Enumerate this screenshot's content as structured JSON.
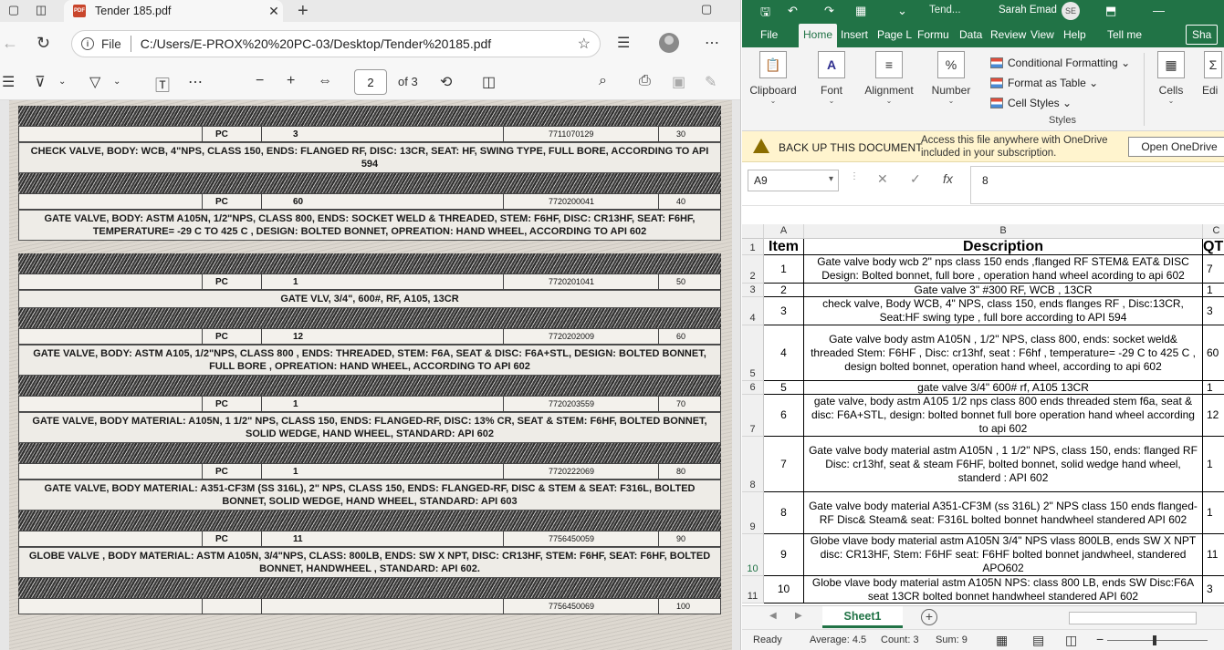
{
  "edge": {
    "tab_title": "Tender 185.pdf",
    "tab_badge": "PDF",
    "url_label": "File",
    "url": "C:/Users/E-PROX%20%20PC-03/Desktop/Tender%20185.pdf",
    "page_current": "2",
    "page_total_label": "of 3"
  },
  "scan": {
    "rows": [
      {
        "pc": "PC",
        "qty": "3",
        "code": "7711070129",
        "no": "30",
        "desc": "CHECK VALVE, BODY: WCB, 4\"NPS, CLASS 150, ENDS: FLANGED RF, DISC: 13CR, SEAT: HF, SWING TYPE, FULL BORE, ACCORDING TO API 594"
      },
      {
        "pc": "PC",
        "qty": "60",
        "code": "7720200041",
        "no": "40",
        "desc": "GATE VALVE, BODY: ASTM A105N, 1/2\"NPS, CLASS 800, ENDS: SOCKET WELD & THREADED, STEM: F6HF, DISC: CR13HF, SEAT: F6HF, TEMPERATURE= -29 C TO 425 C , DESIGN: BOLTED BONNET, OPREATION: HAND WHEEL, ACCORDING TO API 602"
      },
      {
        "pc": "PC",
        "qty": "1",
        "code": "7720201041",
        "no": "50",
        "desc": "GATE VLV, 3/4\", 600#, RF, A105, 13CR"
      },
      {
        "pc": "PC",
        "qty": "12",
        "code": "7720202009",
        "no": "60",
        "desc": "GATE VALVE, BODY: ASTM A105, 1/2\"NPS, CLASS 800 , ENDS: THREADED, STEM: F6A, SEAT & DISC: F6A+STL, DESIGN: BOLTED BONNET, FULL BORE , OPREATION: HAND WHEEL, ACCORDING TO API 602"
      },
      {
        "pc": "PC",
        "qty": "1",
        "code": "7720203559",
        "no": "70",
        "desc": "GATE VALVE, BODY MATERIAL: A105N, 1 1/2\" NPS, CLASS 150, ENDS: FLANGED-RF, DISC: 13% CR, SEAT & STEM: F6HF, BOLTED BONNET, SOLID WEDGE, HAND WHEEL, STANDARD: API 602"
      },
      {
        "pc": "PC",
        "qty": "1",
        "code": "7720222069",
        "no": "80",
        "desc": "GATE VALVE, BODY MATERIAL: A351-CF3M (SS 316L), 2\" NPS, CLASS 150, ENDS: FLANGED-RF, DISC & STEM & SEAT: F316L, BOLTED BONNET, SOLID WEDGE, HAND WHEEL, STANDARD: API 603"
      },
      {
        "pc": "PC",
        "qty": "11",
        "code": "7756450059",
        "no": "90",
        "desc": "GLOBE VALVE , BODY MATERIAL: ASTM A105N, 3/4\"NPS, CLASS: 800LB, ENDS: SW X NPT, DISC: CR13HF, STEM: F6HF, SEAT: F6HF, BOLTED BONNET, HANDWHEEL , STANDARD: API 602."
      },
      {
        "pc": "",
        "qty": "",
        "code": "7756450069",
        "no": "100",
        "desc": ""
      }
    ]
  },
  "excel": {
    "file_short": "Tend...",
    "user_name": "Sarah Emad",
    "user_initials": "SE",
    "menu": [
      "File",
      "Home",
      "Insert",
      "Page L",
      "Formu",
      "Data",
      "Review",
      "View",
      "Help",
      "Tell me",
      "Sha"
    ],
    "ribbon": {
      "clipboard": "Clipboard",
      "font": "Font",
      "alignment": "Alignment",
      "number": "Number",
      "number_icon": "%",
      "conditional": "Conditional Formatting",
      "format_table": "Format as Table",
      "cell_styles": "Cell Styles",
      "styles": "Styles",
      "cells": "Cells",
      "editing": "Edi"
    },
    "message": {
      "title": "BACK UP THIS DOCUMENT",
      "text": "Access this file anywhere with OneDrive included in your subscription.",
      "button": "Open OneDrive"
    },
    "name_box": "A9",
    "fx_label": "fx",
    "formula_value": "8",
    "columns": [
      "A",
      "B",
      "C"
    ],
    "header": {
      "item": "Item",
      "desc": "Description",
      "qty": "QT"
    },
    "rows": [
      {
        "rownum": "2",
        "item": "1",
        "desc": "Gate valve body wcb 2\" nps class 150 ends ,flanged RF STEM& EAT& DISC Design: Bolted bonnet, full bore , operation hand wheel acording to api 602",
        "qty": "7"
      },
      {
        "rownum": "3",
        "item": "2",
        "desc": "Gate valve 3\" #300 RF, WCB , 13CR",
        "qty": "1"
      },
      {
        "rownum": "4",
        "item": "3",
        "desc": "check valve, Body WCB, 4\" NPS, class 150, ends flanges RF , Disc:13CR, Seat:HF swing type , full bore according to API 594",
        "qty": "3"
      },
      {
        "rownum": "5",
        "item": "4",
        "desc": "Gate valve body astm A105N , 1/2\" NPS, class 800, ends: socket weld& threaded Stem: F6HF , Disc: cr13hf, seat : F6hf , temperature= -29 C to 425 C , design bolted bonnet, operation hand wheel, according to api 602",
        "qty": "60"
      },
      {
        "rownum": "6",
        "item": "5",
        "desc": "gate valve 3/4\" 600# rf, A105 13CR",
        "qty": "1"
      },
      {
        "rownum": "7",
        "item": "6",
        "desc": "gate valve, body astm A105 1/2 nps class 800 ends threaded stem f6a, seat & disc: F6A+STL, design: bolted bonnet full bore operation hand wheel according to api 602",
        "qty": "12"
      },
      {
        "rownum": "8",
        "item": "7",
        "desc": "Gate valve body material astm A105N , 1 1/2\" NPS, class 150, ends: flanged RF Disc: cr13hf, seat & steam F6HF, bolted bonnet, solid wedge hand wheel, standerd : API 602",
        "qty": "1"
      },
      {
        "rownum": "9",
        "item": "8",
        "desc": "Gate valve body material A351-CF3M (ss 316L) 2\" NPS class 150 ends flanged-RF Disc& Steam& seat: F316L bolted bonnet handwheel standered API 602",
        "qty": "1"
      },
      {
        "rownum": "10",
        "item": "9",
        "desc": "Globe vlave body material astm A105N 3/4\" NPS vlass 800LB, ends SW X NPT disc: CR13HF, Stem: F6HF seat: F6HF bolted bonnet jandwheel, standered APO602",
        "qty": "11"
      },
      {
        "rownum": "11",
        "item": "10",
        "desc": "Globe vlave body material astm A105N NPS: class 800 LB, ends SW Disc:F6A seat 13CR bolted bonnet handwheel standered API 602",
        "qty": "3"
      }
    ],
    "header_rownum": "1",
    "sheet_tab": "Sheet1",
    "status": {
      "ready": "Ready",
      "average": "Average: 4.5",
      "count": "Count: 3",
      "sum": "Sum: 9"
    }
  }
}
